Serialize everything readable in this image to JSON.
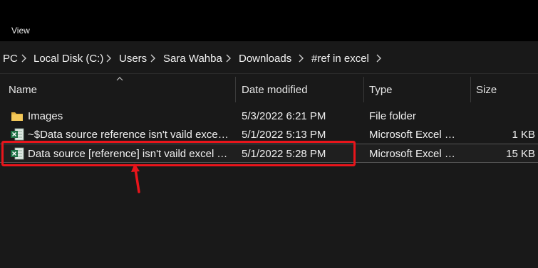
{
  "ribbon": {
    "view_tab": "View"
  },
  "breadcrumb": [
    "PC",
    "Local Disk (C:)",
    "Users",
    "Sara Wahba",
    "Downloads",
    "#ref in excel"
  ],
  "columns": {
    "name": "Name",
    "date": "Date modified",
    "type": "Type",
    "size": "Size"
  },
  "files": [
    {
      "name": "Images",
      "date": "5/3/2022 6:21 PM",
      "type": "File folder",
      "size": "",
      "icon": "folder-icon"
    },
    {
      "name": "~$Data source reference isn't vaild excel Trial.xlsx",
      "date": "5/1/2022 5:13 PM",
      "type": "Microsoft Excel Worksheet",
      "size": "1 KB",
      "icon": "excel-file-icon"
    },
    {
      "name": "Data source [reference] isn't vaild excel Trial.xlsx",
      "date": "5/1/2022 5:28 PM",
      "type": "Microsoft Excel Worksheet",
      "size": "15 KB",
      "icon": "excel-file-icon"
    }
  ],
  "colors": {
    "highlight": "#e8151b",
    "background": "#191919",
    "ribbon": "#000000"
  }
}
